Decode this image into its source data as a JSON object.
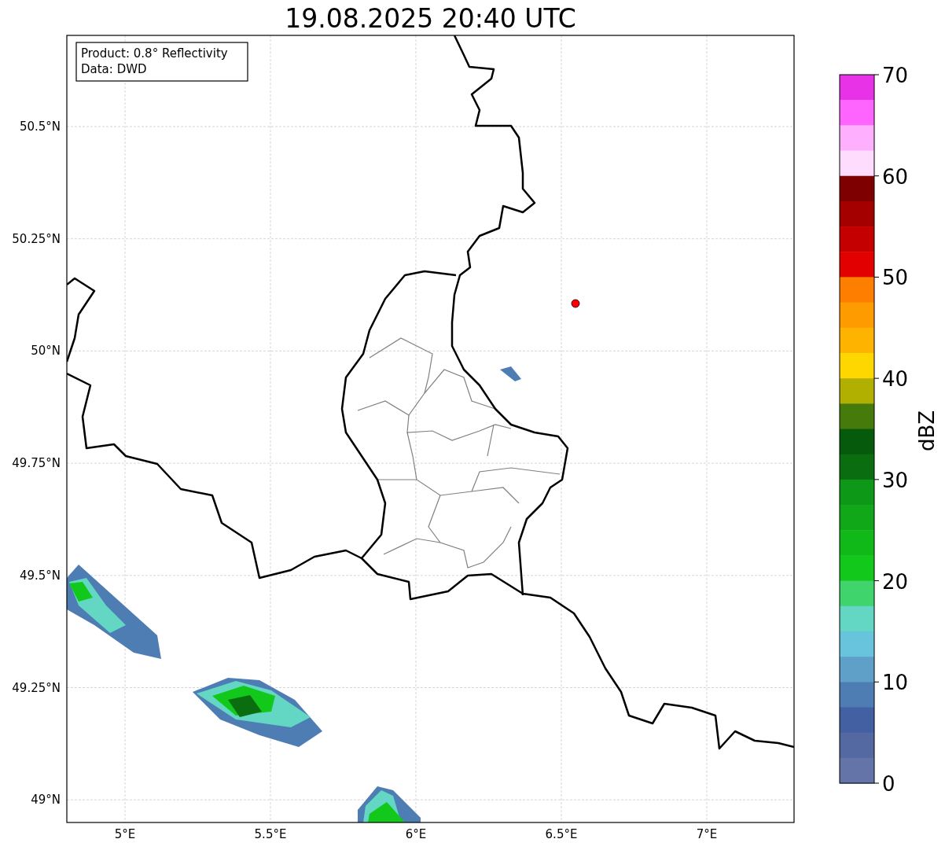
{
  "title": "19.08.2025 20:40 UTC",
  "info_box": [
    "Product: 0.8° Reflectivity",
    "Data: DWD"
  ],
  "lat_labels": [
    "50.5°N",
    "50.25°N",
    "50°N",
    "49.75°N",
    "49.5°N",
    "49.25°N",
    "49°N"
  ],
  "lon_labels": [
    "5°E",
    "5.5°E",
    "6°E",
    "6.5°E",
    "7°E"
  ],
  "colorbar": {
    "label": "dBZ",
    "ticks": [
      "70",
      "60",
      "50",
      "40",
      "30",
      "20",
      "10",
      "0"
    ],
    "segments": [
      {
        "color": "#e832e8"
      },
      {
        "color": "#fe64fe"
      },
      {
        "color": "#feb0fe"
      },
      {
        "color": "#fedcfe"
      },
      {
        "color": "#7e0000"
      },
      {
        "color": "#a50000"
      },
      {
        "color": "#c40000"
      },
      {
        "color": "#e20000"
      },
      {
        "color": "#fe7f00"
      },
      {
        "color": "#fe9b00"
      },
      {
        "color": "#feb300"
      },
      {
        "color": "#fed600"
      },
      {
        "color": "#b1b000"
      },
      {
        "color": "#467a0a"
      },
      {
        "color": "#065a0b"
      },
      {
        "color": "#0a6e10"
      },
      {
        "color": "#0e9818"
      },
      {
        "color": "#10a818"
      },
      {
        "color": "#10b818"
      },
      {
        "color": "#12c81a"
      },
      {
        "color": "#3fd46c"
      },
      {
        "color": "#64d6c4"
      },
      {
        "color": "#68c4dc"
      },
      {
        "color": "#5ea0c8"
      },
      {
        "color": "#4e7db4"
      },
      {
        "color": "#4360a2"
      },
      {
        "color": "#5469a1"
      },
      {
        "color": "#6474a8"
      }
    ]
  }
}
